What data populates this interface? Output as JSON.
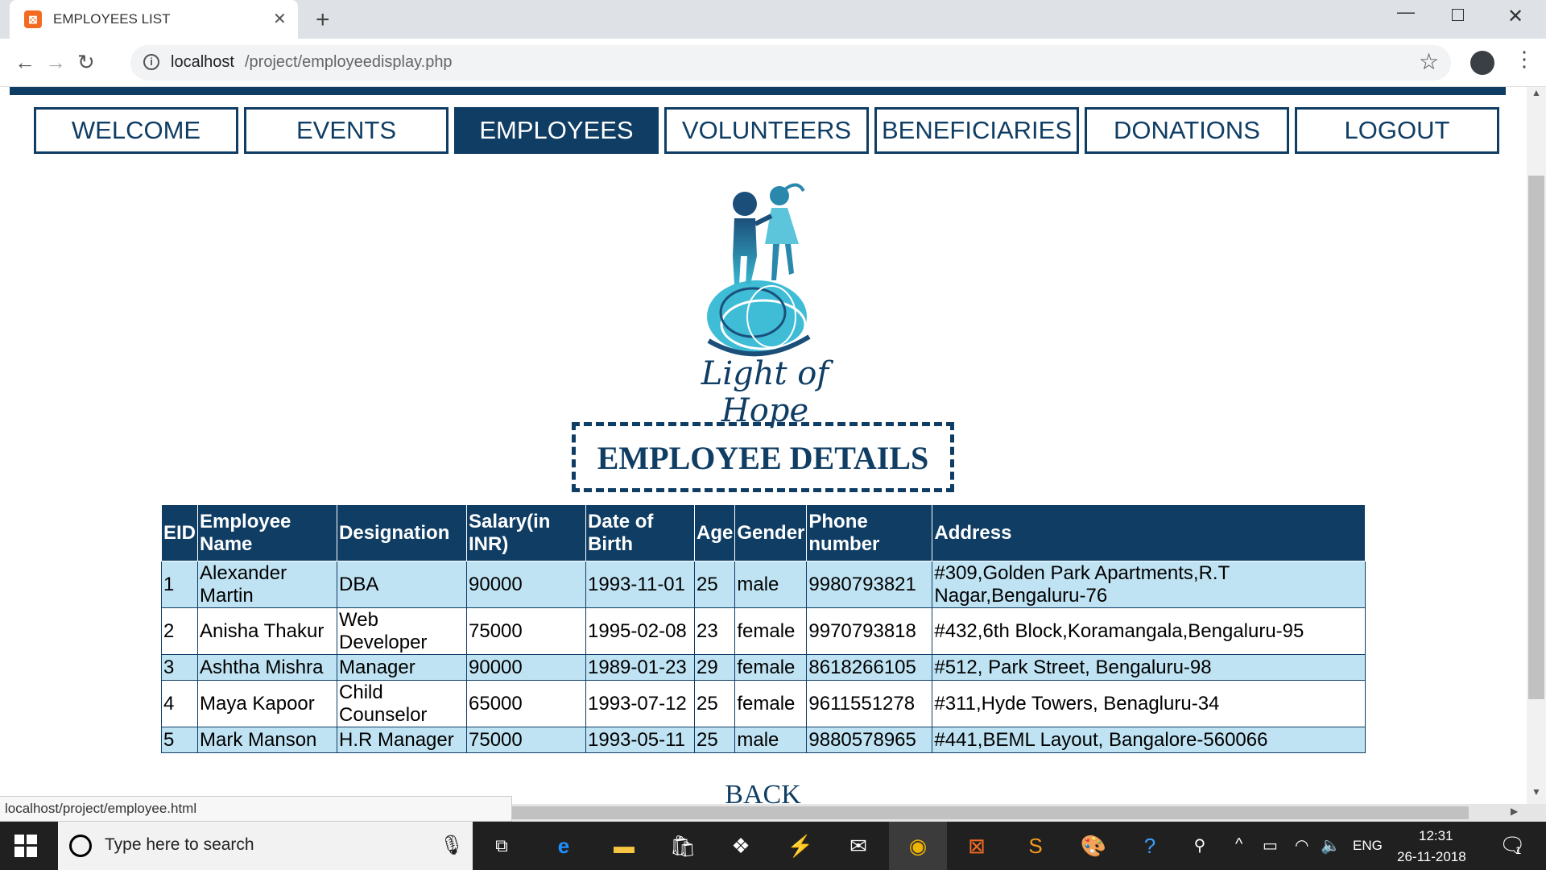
{
  "browser": {
    "tab_title": "EMPLOYEES LIST",
    "tab_favicon": "xampp-icon",
    "url_host": "localhost",
    "url_path": "/project/employeedisplay.php",
    "status_url": "localhost/project/employee.html"
  },
  "menu": {
    "items": [
      "WELCOME",
      "EVENTS",
      "EMPLOYEES",
      "VOLUNTEERS",
      "BENEFICIARIES",
      "DONATIONS",
      "LOGOUT"
    ],
    "active": "EMPLOYEES"
  },
  "logo": {
    "text": "Light of Hope"
  },
  "heading": "EMPLOYEE DETAILS",
  "table": {
    "headers": [
      "EID",
      "Employee Name",
      "Designation",
      "Salary(in INR)",
      "Date of Birth",
      "Age",
      "Gender",
      "Phone number",
      "Address"
    ],
    "rows": [
      [
        "1",
        "Alexander Martin",
        "DBA",
        "90000",
        "1993-11-01",
        "25",
        "male",
        "9980793821",
        "#309,Golden Park Apartments,R.T Nagar,Bengaluru-76"
      ],
      [
        "2",
        "Anisha Thakur",
        "Web Developer",
        "75000",
        "1995-02-08",
        "23",
        "female",
        "9970793818",
        "#432,6th Block,Koramangala,Bengaluru-95"
      ],
      [
        "3",
        "Ashtha Mishra",
        "Manager",
        "90000",
        "1989-01-23",
        "29",
        "female",
        "8618266105",
        "#512, Park Street, Bengaluru-98"
      ],
      [
        "4",
        "Maya Kapoor",
        "Child Counselor",
        "65000",
        "1993-07-12",
        "25",
        "female",
        "9611551278",
        "#311,Hyde Towers, Benagluru-34"
      ],
      [
        "5",
        "Mark Manson",
        "H.R Manager",
        "75000",
        "1993-05-11",
        "25",
        "male",
        "9880578965",
        "#441,BEML Layout, Bangalore-560066"
      ]
    ]
  },
  "back_link": "BACK",
  "taskbar": {
    "search_placeholder": "Type here to search",
    "lang": "ENG",
    "time": "12:31",
    "date": "26-11-2018",
    "notifications": "1"
  },
  "colors": {
    "brand": "#0f3d64",
    "row_alt": "#bfe3f3"
  }
}
